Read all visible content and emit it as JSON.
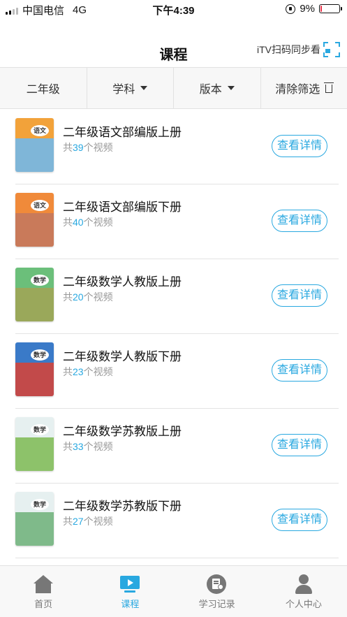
{
  "status_bar": {
    "carrier": "中国电信",
    "network": "4G",
    "time": "下午4:39",
    "battery_text": "9%",
    "battery_level": 0.09
  },
  "nav": {
    "title": "课程",
    "scan_label": "iTV扫码同步看"
  },
  "filters": [
    {
      "label": "二年级",
      "has_caret": false
    },
    {
      "label": "学科",
      "has_caret": true
    },
    {
      "label": "版本",
      "has_caret": true
    },
    {
      "label": "清除筛选",
      "has_caret": false
    }
  ],
  "courses": [
    {
      "title": "二年级语文部编版上册",
      "prefix": "共",
      "count": "39",
      "suffix": "个视频",
      "button": "查看详情",
      "cover_label": "语文",
      "cover_top": "#f2a23a",
      "cover_bottom": "#7fb6d8"
    },
    {
      "title": "二年级语文部编版下册",
      "prefix": "共",
      "count": "40",
      "suffix": "个视频",
      "button": "查看详情",
      "cover_label": "语文",
      "cover_top": "#f08a3a",
      "cover_bottom": "#c97a5a"
    },
    {
      "title": "二年级数学人教版上册",
      "prefix": "共",
      "count": "20",
      "suffix": "个视频",
      "button": "查看详情",
      "cover_label": "数学",
      "cover_top": "#6bbf7a",
      "cover_bottom": "#9aa85a"
    },
    {
      "title": "二年级数学人教版下册",
      "prefix": "共",
      "count": "23",
      "suffix": "个视频",
      "button": "查看详情",
      "cover_label": "数学",
      "cover_top": "#3a7ac8",
      "cover_bottom": "#c24a4a"
    },
    {
      "title": "二年级数学苏教版上册",
      "prefix": "共",
      "count": "33",
      "suffix": "个视频",
      "button": "查看详情",
      "cover_label": "数学",
      "cover_top": "#e6f0f0",
      "cover_bottom": "#8dc26a"
    },
    {
      "title": "二年级数学苏教版下册",
      "prefix": "共",
      "count": "27",
      "suffix": "个视频",
      "button": "查看详情",
      "cover_label": "数学",
      "cover_top": "#e6f0f0",
      "cover_bottom": "#7fba8a"
    },
    {
      "title": "",
      "prefix": "",
      "count": "",
      "suffix": "",
      "button": "",
      "cover_label": "",
      "cover_top": "#3a8ad8",
      "cover_bottom": "#3a8ad8"
    }
  ],
  "tabs": [
    {
      "label": "首页",
      "icon": "home-icon",
      "active": false
    },
    {
      "label": "课程",
      "icon": "course-icon",
      "active": true
    },
    {
      "label": "学习记录",
      "icon": "record-icon",
      "active": false
    },
    {
      "label": "个人中心",
      "icon": "person-icon",
      "active": false
    }
  ],
  "colors": {
    "accent": "#29a8e0",
    "battery_low": "#e8344a"
  }
}
